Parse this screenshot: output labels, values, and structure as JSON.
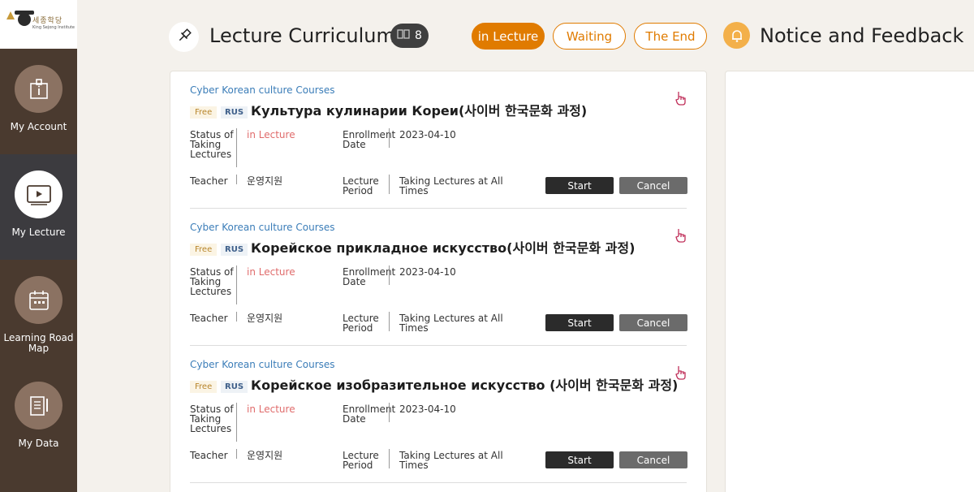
{
  "logo": {
    "korean": "세종학당",
    "english": "King Sejong Institute"
  },
  "sidebar": {
    "items": [
      {
        "label": "My Account",
        "icon": "info-card-icon"
      },
      {
        "label": "My Lecture",
        "icon": "video-play-icon"
      },
      {
        "label": "Learning Road Map",
        "icon": "calendar-icon"
      },
      {
        "label": "My Data",
        "icon": "document-edit-icon"
      }
    ]
  },
  "header": {
    "title": "Lecture Curriculum",
    "count": "8",
    "filters": [
      {
        "label": "in Lecture",
        "active": true
      },
      {
        "label": "Waiting",
        "active": false
      },
      {
        "label": "The End",
        "active": false
      }
    ],
    "notice_title": "Notice and Feedback"
  },
  "labels": {
    "status": "Status of Taking Lectures",
    "enrollment": "Enrollment Date",
    "teacher": "Teacher",
    "period": "Lecture Period",
    "start": "Start",
    "cancel": "Cancel"
  },
  "courses": [
    {
      "category": "Cyber Korean culture Courses",
      "free": "Free",
      "lang": "RUS",
      "title": "Культура кулинарии Кореи(사이버 한국문화 과정)",
      "status": "in Lecture",
      "enrollment_date": "2023-04-10",
      "teacher": "운영지원",
      "period": "Taking Lectures at All Times"
    },
    {
      "category": "Cyber Korean culture Courses",
      "free": "Free",
      "lang": "RUS",
      "title": "Корейское прикладное искусство(사이버 한국문화 과정)",
      "status": "in Lecture",
      "enrollment_date": "2023-04-10",
      "teacher": "운영지원",
      "period": "Taking Lectures at All Times"
    },
    {
      "category": "Cyber Korean culture Courses",
      "free": "Free",
      "lang": "RUS",
      "title": "Корейское изобразительное искусство (사이버 한국문화 과정)",
      "status": "in Lecture",
      "enrollment_date": "2023-04-10",
      "teacher": "운영지원",
      "period": "Taking Lectures at All Times"
    }
  ],
  "colors": {
    "accent": "#e07b00",
    "sidebar": "#4a3a2f",
    "status_red": "#e06c6c",
    "link_blue": "#3b7db8"
  }
}
